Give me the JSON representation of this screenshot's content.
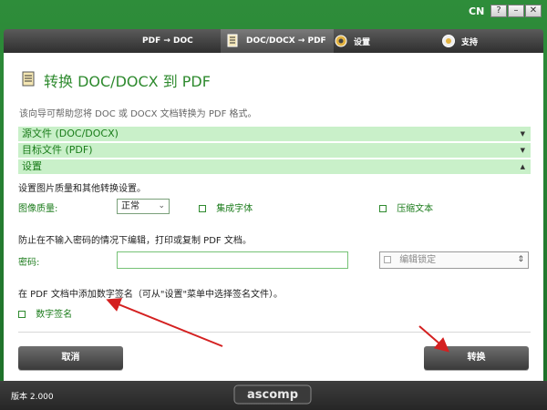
{
  "titlebar": {
    "lang": "CN",
    "help": "?",
    "min": "–",
    "close": "✕"
  },
  "tabs": [
    {
      "label": "PDF → DOC",
      "active": false
    },
    {
      "label": "DOC/DOCX → PDF",
      "active": true
    },
    {
      "label": "设置",
      "active": false
    },
    {
      "label": "支持",
      "active": false
    }
  ],
  "main": {
    "heading": "转换 DOC/DOCX 到 PDF",
    "description": "该向导可帮助您将 DOC 或 DOCX 文档转换为 PDF 格式。",
    "sections": [
      {
        "label": "源文件 (DOC/DOCX)",
        "state": "collapsed"
      },
      {
        "label": "目标文件 (PDF)",
        "state": "collapsed"
      },
      {
        "label": "设置",
        "state": "expanded"
      }
    ],
    "settings_desc": "设置图片质量和其他转换设置。",
    "quality_label": "图像质量:",
    "quality_value": "正常",
    "embed_fonts": "集成字体",
    "compress_text": "压缩文本",
    "protect_desc": "防止在不输入密码的情况下编辑，打印或复制 PDF 文档。",
    "password_label": "密码:",
    "password_value": "",
    "lock_label": "编辑锁定",
    "sign_desc": "在 PDF 文档中添加数字签名（可从\"设置\"菜单中选择签名文件）。",
    "sign_label": "数字签名"
  },
  "buttons": {
    "cancel": "取消",
    "convert": "转换"
  },
  "footer": {
    "version": "版本 2.000",
    "logo": "ascomp"
  },
  "colors": {
    "accent_green": "#2e8a2e",
    "section_bg": "#c9f0c9",
    "annotation_red": "#d42020"
  }
}
